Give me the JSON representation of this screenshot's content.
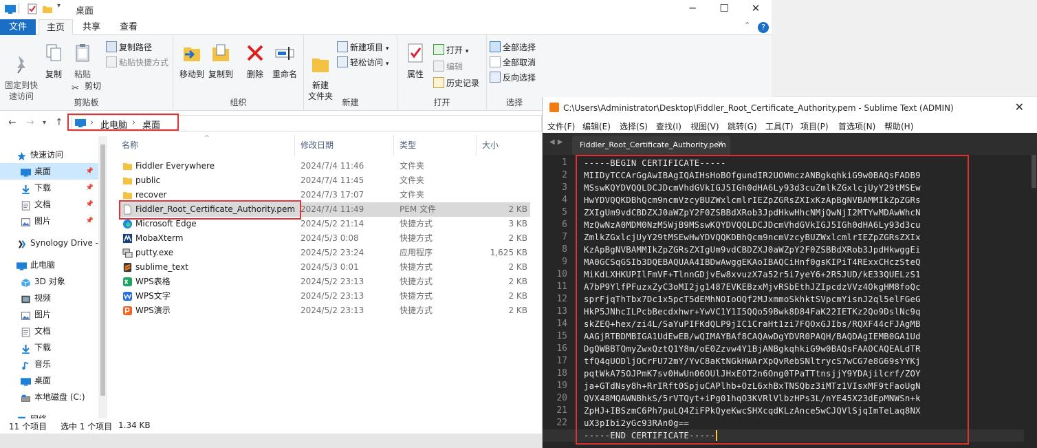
{
  "explorer": {
    "title": "桌面",
    "tabs": [
      "文件",
      "主页",
      "共享",
      "查看"
    ],
    "ribbon": {
      "clipboard": {
        "label": "剪贴板",
        "pin": "固定到快\n速访问",
        "copy": "复制",
        "paste": "粘贴",
        "copy_path": "复制路径",
        "paste_shortcut": "粘贴快捷方式",
        "cut": "剪切"
      },
      "organize": {
        "label": "组织",
        "move_to": "移动到",
        "copy_to": "复制到",
        "delete": "删除",
        "rename": "重命名"
      },
      "new": {
        "label": "新建",
        "new_folder": "新建\n文件夹",
        "new_item": "新建项目",
        "easy_access": "轻松访问"
      },
      "open": {
        "label": "打开",
        "properties": "属性",
        "open": "打开",
        "edit": "编辑",
        "history": "历史记录"
      },
      "select": {
        "label": "选择",
        "select_all": "全部选择",
        "select_none": "全部取消",
        "invert": "反向选择"
      }
    },
    "address": {
      "crumbs": [
        "此电脑",
        "桌面"
      ]
    },
    "nav": [
      {
        "label": "快速访问",
        "icon": "star-icon",
        "pinned": false,
        "selected": false
      },
      {
        "label": "桌面",
        "icon": "desktop-icon",
        "pinned": true,
        "selected": true
      },
      {
        "label": "下载",
        "icon": "download-icon",
        "pinned": true,
        "selected": false
      },
      {
        "label": "文档",
        "icon": "document-icon",
        "pinned": true,
        "selected": false
      },
      {
        "label": "图片",
        "icon": "picture-icon",
        "pinned": true,
        "selected": false
      },
      {
        "label": "Synology Drive -",
        "icon": "synology-icon",
        "pinned": false,
        "selected": false
      },
      {
        "label": "此电脑",
        "icon": "computer-icon",
        "pinned": false,
        "selected": false
      },
      {
        "label": "3D 对象",
        "icon": "3d-objects-icon",
        "pinned": false,
        "selected": false
      },
      {
        "label": "视频",
        "icon": "video-icon",
        "pinned": false,
        "selected": false
      },
      {
        "label": "图片",
        "icon": "picture-icon",
        "pinned": false,
        "selected": false
      },
      {
        "label": "文档",
        "icon": "document-icon",
        "pinned": false,
        "selected": false
      },
      {
        "label": "下载",
        "icon": "download-icon",
        "pinned": false,
        "selected": false
      },
      {
        "label": "音乐",
        "icon": "music-icon",
        "pinned": false,
        "selected": false
      },
      {
        "label": "桌面",
        "icon": "desktop-icon",
        "pinned": false,
        "selected": false
      },
      {
        "label": "本地磁盘 (C:)",
        "icon": "disk-icon",
        "pinned": false,
        "selected": false
      },
      {
        "label": "网络",
        "icon": "network-icon",
        "pinned": false,
        "selected": false
      }
    ],
    "columns": [
      "名称",
      "修改日期",
      "类型",
      "大小"
    ],
    "files": [
      {
        "name": "Fiddler Everywhere",
        "date": "2024/7/4 11:46",
        "type": "文件夹",
        "size": "",
        "icon": "folder-icon"
      },
      {
        "name": "public",
        "date": "2024/7/4 11:45",
        "type": "文件夹",
        "size": "",
        "icon": "folder-icon"
      },
      {
        "name": "recover",
        "date": "2024/7/3 17:07",
        "type": "文件夹",
        "size": "",
        "icon": "folder-icon"
      },
      {
        "name": "Fiddler_Root_Certificate_Authority.pem",
        "date": "2024/7/4 11:49",
        "type": "PEM 文件",
        "size": "2 KB",
        "icon": "file-icon",
        "selected": true
      },
      {
        "name": "Microsoft Edge",
        "date": "2024/5/2 21:14",
        "type": "快捷方式",
        "size": "3 KB",
        "icon": "edge-icon"
      },
      {
        "name": "MobaXterm",
        "date": "2024/5/3 0:08",
        "type": "快捷方式",
        "size": "2 KB",
        "icon": "mobaxterm-icon"
      },
      {
        "name": "putty.exe",
        "date": "2024/5/2 23:24",
        "type": "应用程序",
        "size": "1,625 KB",
        "icon": "putty-icon"
      },
      {
        "name": "sublime_text",
        "date": "2024/5/3 0:01",
        "type": "快捷方式",
        "size": "2 KB",
        "icon": "sublime-icon"
      },
      {
        "name": "WPS表格",
        "date": "2024/5/2 23:13",
        "type": "快捷方式",
        "size": "2 KB",
        "icon": "wps-sheet-icon"
      },
      {
        "name": "WPS文字",
        "date": "2024/5/2 23:13",
        "type": "快捷方式",
        "size": "2 KB",
        "icon": "wps-writer-icon"
      },
      {
        "name": "WPS演示",
        "date": "2024/5/2 23:13",
        "type": "快捷方式",
        "size": "2 KB",
        "icon": "wps-presentation-icon"
      }
    ],
    "status": {
      "count": "11 个项目",
      "selected": "选中 1 个项目",
      "size": "1.34 KB"
    }
  },
  "sublime": {
    "title": "C:\\Users\\Administrator\\Desktop\\Fiddler_Root_Certificate_Authority.pem - Sublime Text (ADMIN)",
    "menu": [
      "文件(F)",
      "编辑(E)",
      "选择(S)",
      "查找(I)",
      "视图(V)",
      "跳转(G)",
      "工具(T)",
      "项目(P)",
      "首选项(N)",
      "帮助(H)"
    ],
    "tab": "Fiddler_Root_Certificate_Authority.pem",
    "current_line": 23,
    "lines": [
      "-----BEGIN CERTIFICATE-----",
      "MIIDyTCCArGgAwIBAgIQAIHsHoBOfgundIR2UOWmczANBgkqhkiG9w0BAQsFADB9",
      "MSswKQYDVQQLDCJDcmVhdGVkIGJ5IGh0dHA6Ly93d3cuZmlkZGxlcjUyY29tMSEw",
      "HwYDVQQKDBhQcm9ncmVzcyBUZWxlcmlrIEZpZGRsZXIxKzApBgNVBAMMIkZpZGRs",
      "ZXIgUm9vdCBDZXJ0aWZpY2F0ZSBBdXRob3JpdHkwHhcNMjQwNjI2MTYwMDAwWhcN",
      "MzQwNzA0MDM0NzM5WjB9MSswKQYDVQQLDCJDcmVhdGVkIGJ5IGh0dHA6Ly93d3cu",
      "ZmlkZGxlcjUyY29tMSEwHwYDVQQKDBhQcm9ncmVzcyBUZWxlcmlrIEZpZGRsZXIx",
      "KzApBgNVBAMMIkZpZGRsZXIgUm9vdCBDZXJ0aWZpY2F0ZSBBdXRob3JpdHkwggEi",
      "MA0GCSqGSIb3DQEBAQUAA4IBDwAwggEKAoIBAQCiHnf0gsKIPiT4RExxCHczSteQ",
      "MiKdLXHKUPIlFmVF+TlnnGDjvEw8xvuzX7a52r5i7yeY6+2R5JUD/kE33QUELzS1",
      "A7bP9YlfPFuzxZyC3oMI2jg1487EVKEBzxMjvRSbEthJZIpcdzVVz4OkgHM8foQc",
      "sprFjqThTbx7Dc1x5pcT5dEMhNOIoOQf2MJxmmoSkhktSVpcmYisnJ2ql5elFGeG",
      "HkP5JNhcILPcbBecdxhwr+YwVC1Y1I5QQo59Bwk8D84FaK22IETKz2Qo9DslNc9q",
      "skZEQ+hex/zi4L/SaYuPIFKdQLP9jIC1CraHt1zi7FQOxGJIbs/RQXF44cFJAgMB",
      "AAGjRTBDMBIGA1UdEwEB/wQIMAYBAf8CAQAwDgYDVR0PAQH/BAQDAgIEMB0GA1Ud",
      "DgQWBBTQmyZwxQztQ1Y8m/oE0Zzvw4Y1BjANBgkqhkiG9w0BAQsFAAOCAQEALdTR",
      "tfQ4qUODljOCrFU72mY/YvC8aKtNGkHWArXpQvRebSNltrycS7wCG7e8G69sYYKj",
      "pqtWkA75OJPmK7sv0HwUn06OUlJHxEOT2n6Ong0TPaTTtnsjjY9YDAjilcrf/ZOY",
      "ja+GTdNsy8h+RrIRft0SpjuCAPlhb+OzL6xhBxTNSQbz3iMTz1VIsxMF9tFaoUgN",
      "QVX48MQAWNBhkS/5rVTQyt+iPg01hqO3KVRlVlbzHPs3L/nYE45X23dEpMNWSn+k",
      "ZpHJ+IBSzmC6Ph7puLQ4ZiFPkQyeKwcSHXcqdKLzAnce5wCJQVlSjqImTeLaq8NX",
      "uX3pIbi2yGc93RAn0g==",
      "-----END CERTIFICATE-----"
    ]
  }
}
